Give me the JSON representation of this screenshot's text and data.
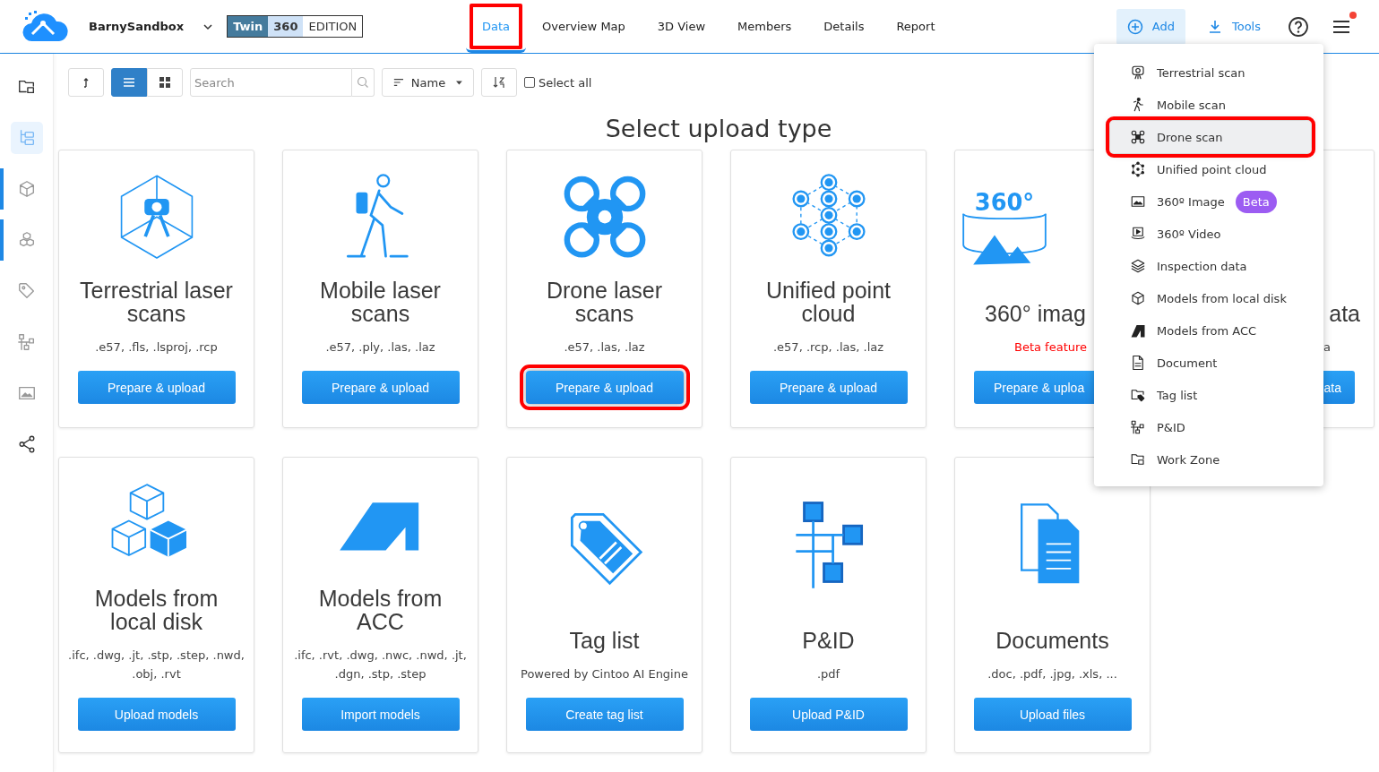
{
  "header": {
    "workspace": "BarnySandbox",
    "edition": [
      "Twin",
      "360",
      "EDITION"
    ],
    "tabs": [
      {
        "label": "Data",
        "selected": true,
        "highlighted": true
      },
      {
        "label": "Overview Map",
        "selected": false,
        "highlighted": false
      },
      {
        "label": "3D View",
        "selected": false,
        "highlighted": false
      },
      {
        "label": "Members",
        "selected": false,
        "highlighted": false
      },
      {
        "label": "Details",
        "selected": false,
        "highlighted": false
      },
      {
        "label": "Report",
        "selected": false,
        "highlighted": false
      }
    ],
    "add": {
      "label": "Add",
      "expanded": true
    },
    "tools": {
      "label": "Tools"
    },
    "notification": true
  },
  "sidebar": {
    "items": [
      {
        "kind": "workzone",
        "selected": false,
        "marked": false
      },
      {
        "kind": "tree",
        "selected": true,
        "marked": false
      },
      {
        "kind": "cube",
        "selected": false,
        "marked": true
      },
      {
        "kind": "cubes",
        "selected": false,
        "marked": true
      },
      {
        "kind": "tag",
        "selected": false,
        "marked": false
      },
      {
        "kind": "pid",
        "selected": false,
        "marked": false
      },
      {
        "kind": "image",
        "selected": false,
        "marked": false
      },
      {
        "kind": "share",
        "selected": false,
        "marked": false
      }
    ]
  },
  "toolbar": {
    "view": [
      {
        "kind": "list",
        "selected": true
      },
      {
        "kind": "grid",
        "selected": false
      }
    ],
    "search": {
      "placeholder": "Search"
    },
    "sort": {
      "label": "Name"
    },
    "select_all": {
      "label": "Select all",
      "checked": false
    }
  },
  "title": "Select upload type",
  "rows": [
    {
      "cards": [
        {
          "kind": "terrestrial",
          "title": "Terrestrial laser scans",
          "subtitle": ".e57, .fls, .lsproj, .rcp",
          "warning": false,
          "button": "Prepare & upload",
          "highlighted": false
        },
        {
          "kind": "mobile",
          "title": "Mobile laser scans",
          "subtitle": ".e57, .ply, .las, .laz",
          "warning": false,
          "button": "Prepare & upload",
          "highlighted": false
        },
        {
          "kind": "drone",
          "title": "Drone laser scans",
          "subtitle": ".e57, .las, .laz",
          "warning": false,
          "button": "Prepare & upload",
          "highlighted": true
        },
        {
          "kind": "unified",
          "title": "Unified point cloud",
          "subtitle": ".e57, .rcp, .las, .laz",
          "warning": false,
          "button": "Prepare & upload",
          "highlighted": false
        },
        {
          "kind": "panorama",
          "icon_text": "360°",
          "title": "360° imag",
          "subtitle": "Beta feature",
          "warning": true,
          "button": "Prepare & uploa",
          "highlighted": false
        },
        {
          "kind": "blank",
          "title": "ata",
          "subtitle": "a",
          "warning": false,
          "button": "ata",
          "highlighted": false
        }
      ]
    },
    {
      "cards": [
        {
          "kind": "models",
          "title": "Models from local disk",
          "subtitle": ".ifc, .dwg, .jt, .stp, .step, .nwd, .obj, .rvt",
          "warning": false,
          "button": "Upload models",
          "highlighted": false
        },
        {
          "kind": "acc",
          "title": "Models from ACC",
          "subtitle": ".ifc, .rvt, .dwg, .nwc, .nwd, .jt, .dgn, .stp, .step",
          "warning": false,
          "button": "Import models",
          "highlighted": false
        },
        {
          "kind": "tag",
          "title": "Tag list",
          "subtitle": "Powered by Cintoo AI Engine",
          "warning": false,
          "button": "Create tag list",
          "highlighted": false
        },
        {
          "kind": "pid",
          "title": "P&ID",
          "subtitle": ".pdf",
          "warning": false,
          "button": "Upload P&ID",
          "highlighted": false
        },
        {
          "kind": "docs",
          "title": "Documents",
          "subtitle": ".doc, .pdf, .jpg, .xls, ...",
          "warning": false,
          "button": "Upload files",
          "highlighted": false
        }
      ]
    }
  ],
  "menu": {
    "items": [
      {
        "kind": "terrestrial",
        "label": "Terrestrial scan",
        "selected": false,
        "highlighted": false
      },
      {
        "kind": "mobile",
        "label": "Mobile scan",
        "selected": false,
        "highlighted": false
      },
      {
        "kind": "drone",
        "label": "Drone scan",
        "selected": true,
        "highlighted": true
      },
      {
        "kind": "unified",
        "label": "Unified point cloud",
        "selected": false,
        "highlighted": false
      },
      {
        "kind": "image",
        "label": "360º Image",
        "badge": "Beta",
        "selected": false,
        "highlighted": false
      },
      {
        "kind": "video",
        "label": "360º Video",
        "selected": false,
        "highlighted": false
      },
      {
        "kind": "layers",
        "label": "Inspection data",
        "selected": false,
        "highlighted": false
      },
      {
        "kind": "cube",
        "label": "Models from local disk",
        "selected": false,
        "highlighted": false
      },
      {
        "kind": "acc",
        "label": "Models from ACC",
        "selected": false,
        "highlighted": false
      },
      {
        "kind": "doc",
        "label": "Document",
        "selected": false,
        "highlighted": false
      },
      {
        "kind": "tagfolder",
        "label": "Tag list",
        "selected": false,
        "highlighted": false
      },
      {
        "kind": "pid",
        "label": "P&ID",
        "selected": false,
        "highlighted": false
      },
      {
        "kind": "workzone",
        "label": "Work Zone",
        "selected": false,
        "highlighted": false
      }
    ]
  }
}
